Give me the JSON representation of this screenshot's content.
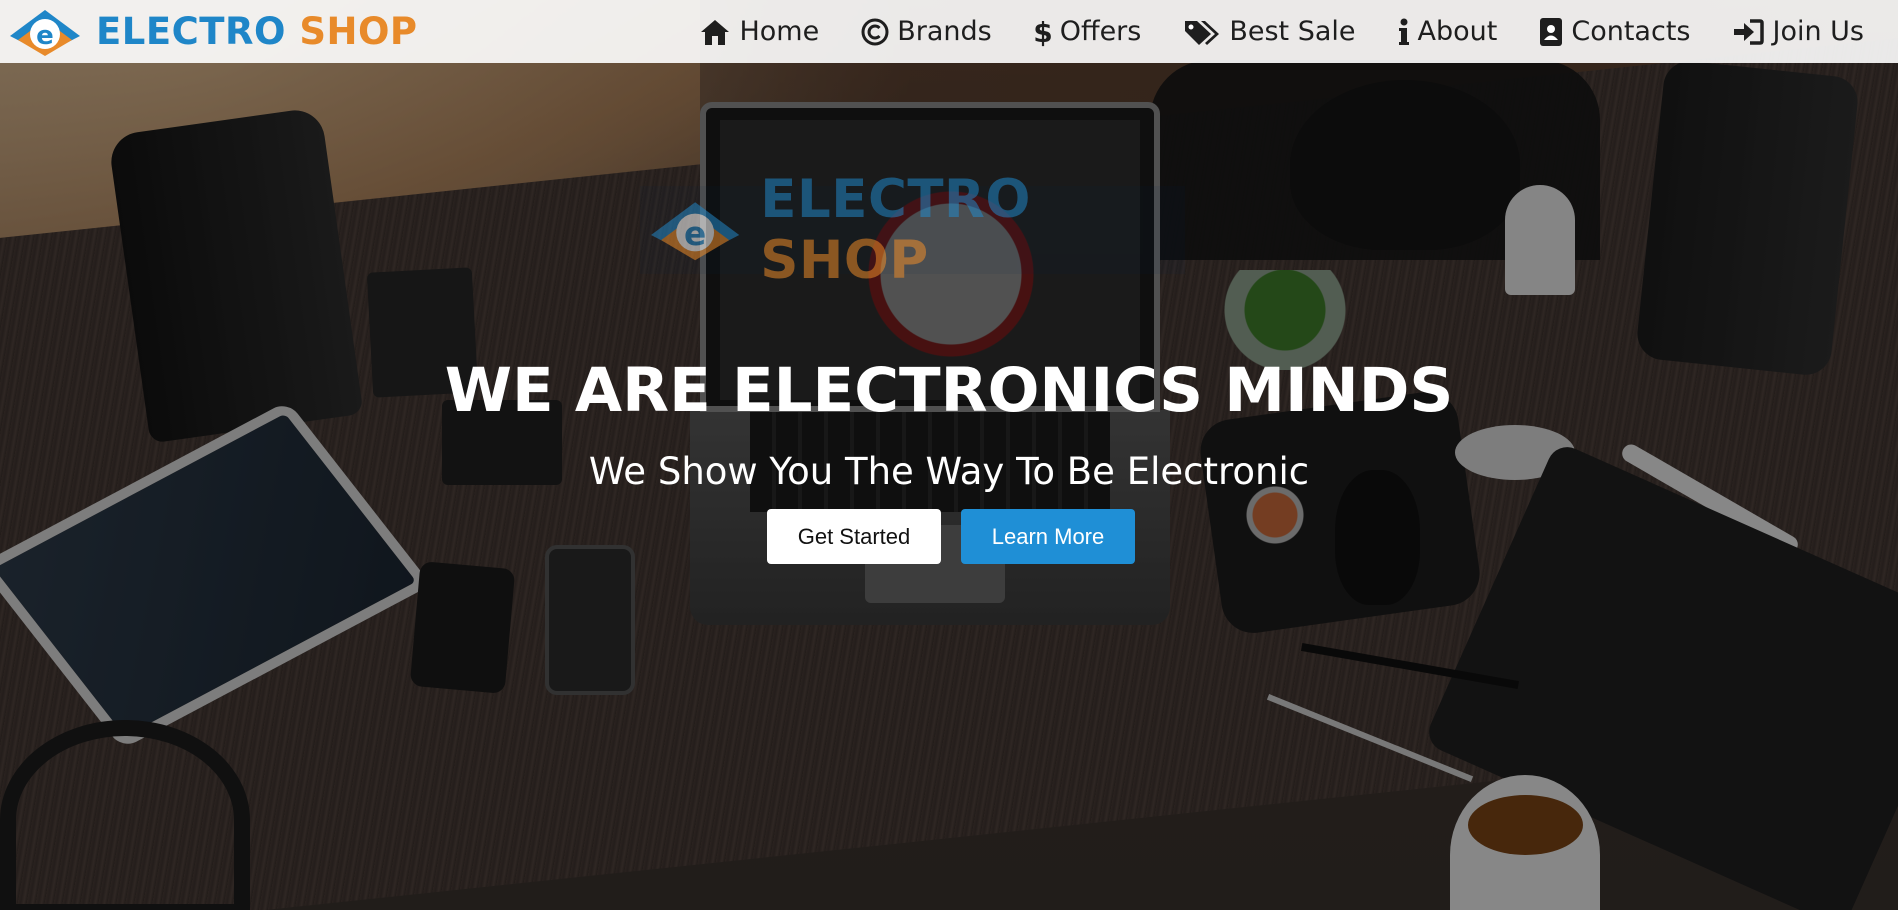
{
  "brand": {
    "name_part1": "ELECTRO",
    "name_part2": "SHOP"
  },
  "nav": {
    "items": [
      {
        "label": "Home",
        "icon": "home-icon"
      },
      {
        "label": "Brands",
        "icon": "copyright-icon"
      },
      {
        "label": "Offers",
        "icon": "dollar-icon"
      },
      {
        "label": "Best Sale",
        "icon": "tags-icon"
      },
      {
        "label": "About",
        "icon": "info-icon"
      },
      {
        "label": "Contacts",
        "icon": "contact-card-icon"
      },
      {
        "label": "Join Us",
        "icon": "sign-in-icon"
      }
    ]
  },
  "hero": {
    "logo_part1": "ELECTRO",
    "logo_part2": "SHOP",
    "headline": "WE ARE ELECTRONICS MINDS",
    "subline": "We Show You The Way To Be Electronic",
    "get_started_label": "Get Started",
    "learn_more_label": "Learn More"
  },
  "colors": {
    "brand_blue": "#1f86c8",
    "brand_orange": "#e88a2a",
    "learn_more_bg": "#1f8fd6",
    "header_bg": "#ffffff"
  }
}
